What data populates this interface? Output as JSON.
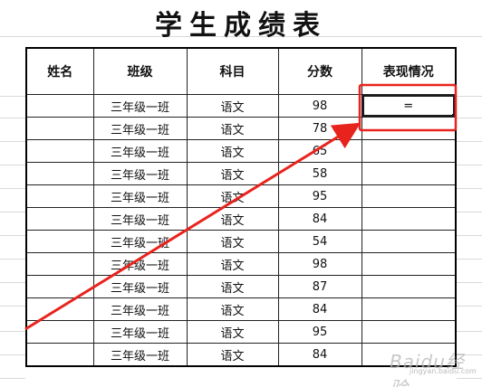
{
  "title": "学生成绩表",
  "columns": [
    "姓名",
    "班级",
    "科目",
    "分数",
    "表现情况"
  ],
  "active_cell_value": "=",
  "rows": [
    {
      "name": "",
      "class": "三年级一班",
      "subject": "语文",
      "score": "98"
    },
    {
      "name": "",
      "class": "三年级一班",
      "subject": "语文",
      "score": "78"
    },
    {
      "name": "",
      "class": "三年级一班",
      "subject": "语文",
      "score": "65"
    },
    {
      "name": "",
      "class": "三年级一班",
      "subject": "语文",
      "score": "58"
    },
    {
      "name": "",
      "class": "三年级一班",
      "subject": "语文",
      "score": "95"
    },
    {
      "name": "",
      "class": "三年级一班",
      "subject": "语文",
      "score": "84"
    },
    {
      "name": "",
      "class": "三年级一班",
      "subject": "语文",
      "score": "54"
    },
    {
      "name": "",
      "class": "三年级一班",
      "subject": "语文",
      "score": "98"
    },
    {
      "name": "",
      "class": "三年级一班",
      "subject": "语文",
      "score": "87"
    },
    {
      "name": "",
      "class": "三年级一班",
      "subject": "语文",
      "score": "84"
    },
    {
      "name": "",
      "class": "三年级一班",
      "subject": "语文",
      "score": "95"
    },
    {
      "name": "",
      "class": "三年级一班",
      "subject": "语文",
      "score": "84"
    }
  ],
  "annotation": {
    "color": "#e8231d"
  },
  "watermark": {
    "text": "Baidu经验",
    "sub": "jingyan.baidu.com"
  }
}
